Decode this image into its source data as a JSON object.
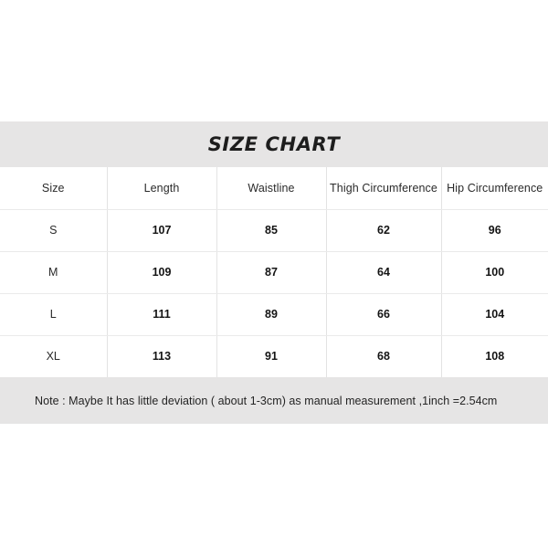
{
  "document": {
    "title": "SIZE CHART"
  },
  "table": {
    "columns": [
      "Size",
      "Length",
      "Waistline",
      "Thigh Circumference",
      "Hip Circumference"
    ],
    "rows": [
      {
        "size": "S",
        "length": "107",
        "waistline": "85",
        "thigh": "62",
        "hip": "96"
      },
      {
        "size": "M",
        "length": "109",
        "waistline": "87",
        "thigh": "64",
        "hip": "100"
      },
      {
        "size": "L",
        "length": "111",
        "waistline": "89",
        "thigh": "66",
        "hip": "104"
      },
      {
        "size": "XL",
        "length": "113",
        "waistline": "91",
        "thigh": "68",
        "hip": "108"
      }
    ]
  },
  "note": {
    "text": "Note : Maybe It has little deviation ( about 1-3cm) as manual measurement ,1inch =2.54cm"
  },
  "colors": {
    "band_background": "#e6e5e5",
    "page_background": "#ffffff",
    "border": "#e3e3e3",
    "text": "#1f1f1f"
  }
}
